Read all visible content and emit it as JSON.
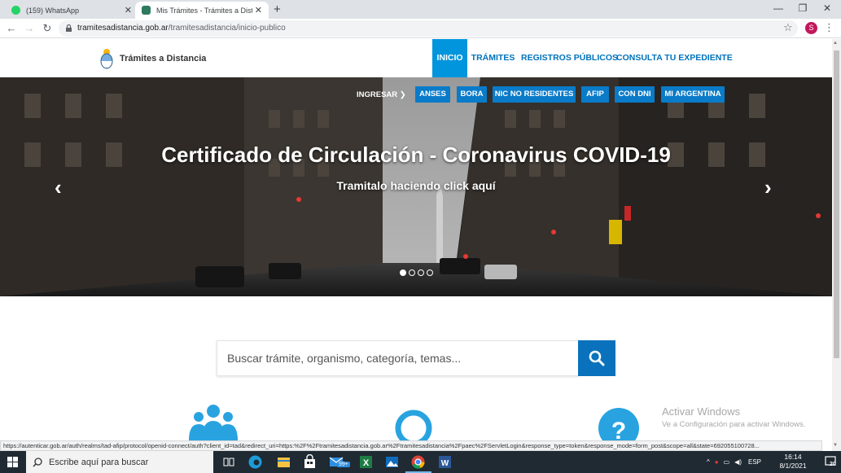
{
  "browser": {
    "tabs": [
      {
        "title": "(159) WhatsApp",
        "active": false
      },
      {
        "title": "Mis Trámites - Trámites a Distancia",
        "active": true
      }
    ],
    "url_host": "tramitesadistancia.gob.ar",
    "url_path": "/tramitesadistancia/inicio-publico",
    "profile_initial": "S",
    "status_url": "https://autenticar.gob.ar/auth/realms/tad-afip/protocol/openid-connect/auth?client_id=tad&redirect_uri=https:%2F%2Ftramitesadistancia.gob.ar%2Ftramitesadistancia%2Fpaec%2FServletLogin&response_type=token&response_mode=form_post&scope=all&state=692055100728..."
  },
  "site": {
    "logo_text": "Trámites a Distancia",
    "nav": {
      "inicio": "INICIO",
      "tramites": "TRÁMITES",
      "registros": "REGISTROS PÚBLICOS",
      "consulta": "CONSULTA TU EXPEDIENTE"
    },
    "accent_color": "#0095dc",
    "link_color": "#0072bb"
  },
  "hero": {
    "ingresar": "INGRESAR",
    "services": [
      "ANSES",
      "BORA",
      "NIC NO RESIDENTES",
      "AFIP",
      "CON DNI",
      "MI ARGENTINA"
    ],
    "title": "Certificado de Circulación - Coronavirus COVID-19",
    "subtitle": "Tramitalo haciendo click aquí",
    "slides": 4,
    "active_slide": 1
  },
  "search": {
    "placeholder": "Buscar trámite, organismo, categoría, temas..."
  },
  "watermark": {
    "line1": "Activar Windows",
    "line2": "Ve a Configuración para activar Windows."
  },
  "taskbar": {
    "search_placeholder": "Escribe aquí para buscar",
    "mail_badge": "99+",
    "language": "ESP",
    "time": "16:14",
    "date": "8/1/2021",
    "notification_count": "20"
  }
}
